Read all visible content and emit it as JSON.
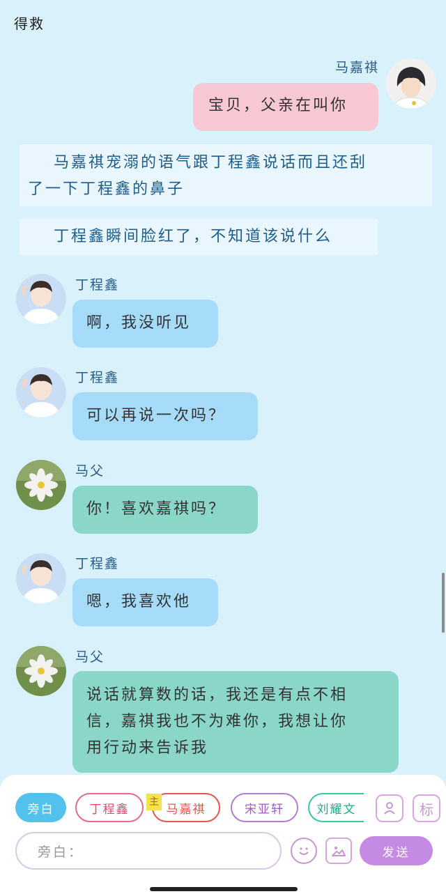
{
  "header": {
    "title": "得救"
  },
  "messages": {
    "m1": {
      "name": "马嘉祺",
      "text": "宝贝，父亲在叫你"
    },
    "n1": {
      "line1": "　马嘉祺宠溺的语气跟丁程鑫说话而且还刮",
      "line2": "了一下丁程鑫的鼻子"
    },
    "n2": {
      "text": "　丁程鑫瞬间脸红了，不知道该说什么"
    },
    "m2": {
      "name": "丁程鑫",
      "text": "啊，我没听见"
    },
    "m3": {
      "name": "丁程鑫",
      "text": "可以再说一次吗？"
    },
    "m4": {
      "name": "马父",
      "text": "你！喜欢嘉祺吗？"
    },
    "m5": {
      "name": "丁程鑫",
      "text": "嗯，我喜欢他"
    },
    "m6": {
      "name": "马父",
      "line1": "说话就算数的话，我还是有点不相",
      "line2": "信，嘉祺我也不为难你，我想让你",
      "line3": "用行动来告诉我"
    }
  },
  "composer": {
    "chips": [
      "旁白",
      "丁程鑫",
      "马嘉祺",
      "宋亚轩",
      "刘耀文"
    ],
    "main_tag": "主",
    "label_button": "标",
    "input_placeholder": "旁白：",
    "send_label": "发送"
  },
  "colors": {
    "background": "#d9f1fb",
    "self_bubble": "#f8c9d4",
    "blue_bubble": "#a6dcf9",
    "green_bubble": "#8ad6c9",
    "accent": "#52c2ec",
    "send": "#c48ae4"
  }
}
